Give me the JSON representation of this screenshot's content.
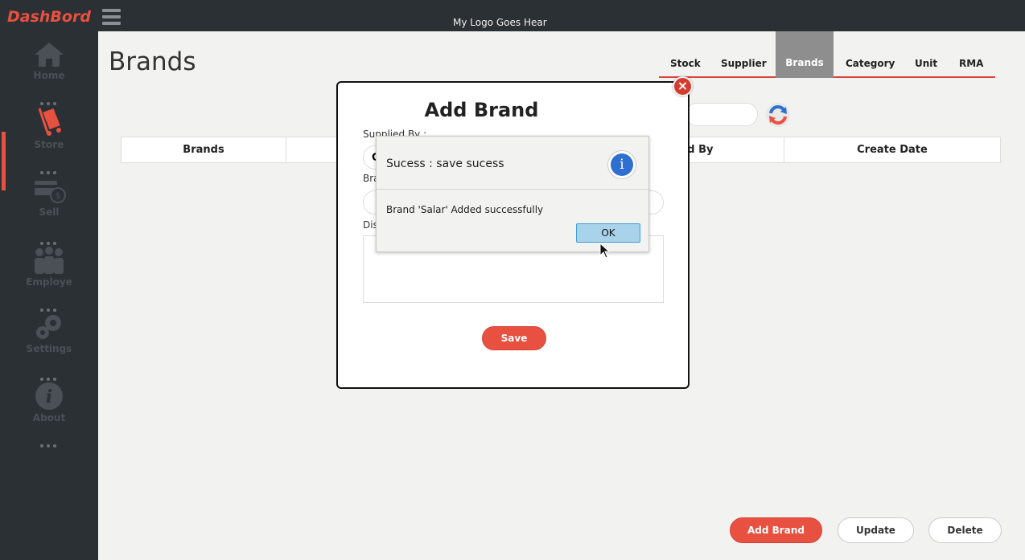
{
  "app": {
    "logo_text": "DashBord",
    "header_title": "My Logo Goes Hear"
  },
  "sidebar": {
    "items": [
      {
        "label": "Home",
        "icon": "home-icon"
      },
      {
        "label": "Store",
        "icon": "store-icon",
        "active": true
      },
      {
        "label": "Sell",
        "icon": "sell-icon"
      },
      {
        "label": "Employe",
        "icon": "employee-icon"
      },
      {
        "label": "Settings",
        "icon": "settings-icon"
      },
      {
        "label": "About",
        "icon": "about-icon"
      }
    ]
  },
  "main": {
    "page_title": "Brands",
    "tabs": [
      "Stock",
      "Supplier",
      "Brands",
      "Category",
      "Unit",
      "RMA"
    ],
    "active_tab": "Brands",
    "table_headers": [
      "Brands",
      "",
      "dd By",
      "Create Date"
    ],
    "buttons": {
      "add": "Add Brand",
      "update": "Update",
      "delete": "Delete"
    }
  },
  "dialog": {
    "title": "Add Brand",
    "supplied_by_label": "Supplied By :",
    "supplied_by_value": "G",
    "brand_label": "Bra",
    "brand_value": "",
    "description_label": "Dis",
    "save_label": "Save",
    "close_symbol": "×"
  },
  "popup": {
    "title": "Sucess : save sucess",
    "message": "Brand  'Salar' Added successfully",
    "ok_label": "OK",
    "info_symbol": "i"
  },
  "colors": {
    "accent": "#e8503f",
    "sidebar_bg": "#2b3035",
    "content_bg": "#f2f2f0",
    "info_blue": "#2e6fd0"
  }
}
